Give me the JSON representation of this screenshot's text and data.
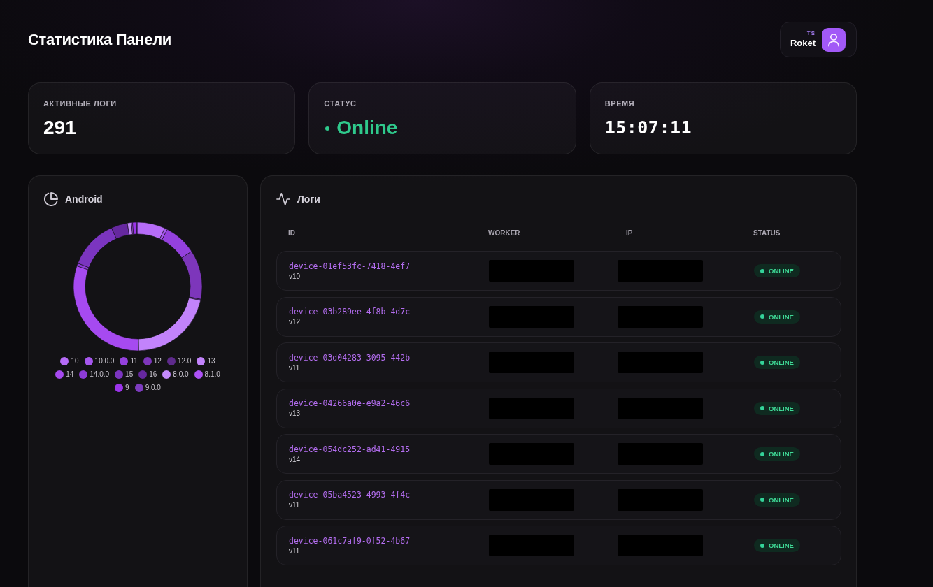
{
  "header": {
    "title": "Статистика Панели",
    "user": {
      "initials": "TS",
      "name": "Roket"
    }
  },
  "stats": [
    {
      "kind": "count",
      "label": "АКТИВНЫЕ ЛОГИ",
      "value": "291"
    },
    {
      "kind": "status",
      "label": "СТАТУС",
      "value": "Online",
      "online": true
    },
    {
      "kind": "time",
      "label": "ВРЕМЯ",
      "value": "15:07:11"
    }
  ],
  "android": {
    "title": "Android",
    "chart_data": {
      "type": "donut",
      "categories": [
        "10",
        "10.0.0",
        "11",
        "12",
        "12.0",
        "13",
        "14",
        "14.0.0",
        "15",
        "16",
        "8.0.0",
        "8.1.0",
        "9",
        "9.0.0"
      ],
      "values": [
        6.9,
        0.7,
        8.2,
        12.4,
        0.3,
        21.3,
        30.4,
        0.7,
        12.4,
        4.1,
        1.0,
        0.3,
        1.0,
        0.3
      ],
      "colors": [
        "#b66cf7",
        "#a657ee",
        "#9441dd",
        "#7d36bb",
        "#5e2a8c",
        "#c283fb",
        "#a64af0",
        "#8c3bd6",
        "#7b35c0",
        "#66289f",
        "#c48afc",
        "#ad52f5",
        "#9b34ea",
        "#7d3cbf"
      ]
    }
  },
  "logs": {
    "title": "Логи",
    "columns": [
      "ID",
      "WORKER",
      "IP",
      "STATUS"
    ],
    "rows": [
      {
        "id": "device-01ef53fc-7418-4ef7",
        "version": "v10",
        "worker_redacted": true,
        "ip_redacted": true,
        "status": "ONLINE",
        "online": true
      },
      {
        "id": "device-03b289ee-4f8b-4d7c",
        "version": "v12",
        "worker_redacted": true,
        "ip_redacted": true,
        "status": "ONLINE",
        "online": true
      },
      {
        "id": "device-03d04283-3095-442b",
        "version": "v11",
        "worker_redacted": true,
        "ip_redacted": true,
        "status": "ONLINE",
        "online": true
      },
      {
        "id": "device-04266a0e-e9a2-46c6",
        "version": "v13",
        "worker_redacted": true,
        "ip_redacted": true,
        "status": "ONLINE",
        "online": true
      },
      {
        "id": "device-054dc252-ad41-4915",
        "version": "v14",
        "worker_redacted": true,
        "ip_redacted": true,
        "status": "ONLINE",
        "online": true
      },
      {
        "id": "device-05ba4523-4993-4f4c",
        "version": "v11",
        "worker_redacted": true,
        "ip_redacted": true,
        "status": "ONLINE",
        "online": true
      },
      {
        "id": "device-061c7af9-0f52-4b67",
        "version": "v11",
        "worker_redacted": true,
        "ip_redacted": true,
        "status": "ONLINE",
        "online": true
      }
    ]
  }
}
